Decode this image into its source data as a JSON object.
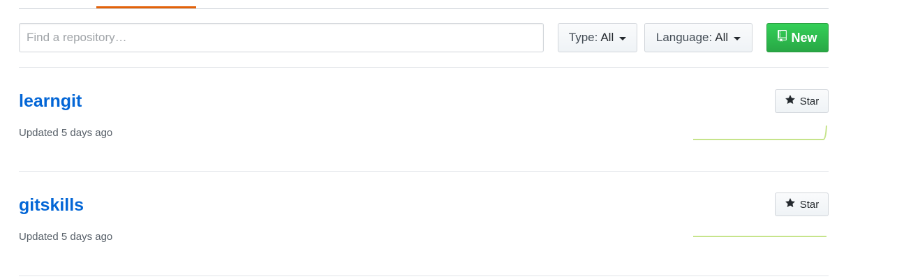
{
  "search": {
    "placeholder": "Find a repository…",
    "value": ""
  },
  "filters": {
    "type_prefix": "Type:",
    "type_value": "All",
    "language_prefix": "Language:",
    "language_value": "All",
    "new_label": "New"
  },
  "repos": [
    {
      "name": "learngit",
      "updated": "Updated 5 days ago",
      "star_label": "Star",
      "activity": [
        0,
        0,
        0,
        0,
        0,
        0,
        0,
        0,
        0,
        0,
        0,
        0,
        0,
        0,
        0,
        0,
        0,
        0,
        0,
        1
      ]
    },
    {
      "name": "gitskills",
      "updated": "Updated 5 days ago",
      "star_label": "Star",
      "activity": [
        0,
        0,
        0,
        0,
        0,
        0,
        0,
        0,
        0,
        0,
        0,
        0,
        0,
        0,
        0,
        0,
        0,
        0,
        0,
        0
      ]
    }
  ],
  "colors": {
    "link": "#0366d6",
    "new_button": "#28a745",
    "active_tab": "#e36209",
    "sparkline": "#c6e48b"
  }
}
